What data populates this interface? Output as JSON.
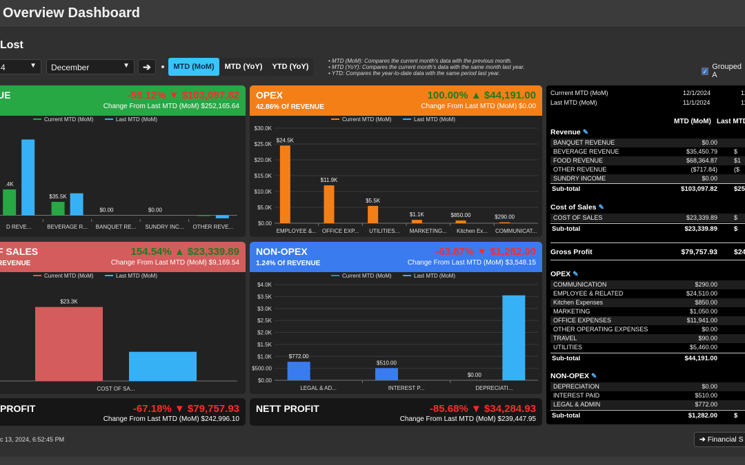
{
  "page": {
    "title": "Overview Dashboard",
    "section": "Lost",
    "timestamp": "c 13, 2024, 6:52:45 PM"
  },
  "controls": {
    "year_value": "4",
    "month_value": "December",
    "go_icon": "arrow-right-icon",
    "modes": [
      "MTD (MoM)",
      "MTD (YoY)",
      "YTD (YoY)"
    ],
    "active_mode": "MTD (MoM)",
    "notes": [
      "MTD (MoM): Compares the current month's data with the previous month.",
      "MTD (YoY): Compares the current month's data with the same month last year.",
      "YTD: Compares the year-to-date data with the same period last year."
    ],
    "grouped_label": "Grouped A"
  },
  "colors": {
    "current": "#1e8bd8",
    "last": "#37b1f5",
    "revenue": "#28a745",
    "opex": "#f57f17",
    "cos": "#d55c5c",
    "nonopex": "#3a7bf0",
    "up": "#22cc55",
    "down": "#ff2222"
  },
  "cards": {
    "revenue": {
      "title": "UE",
      "big": "-59.12% ▼ $103,097.82",
      "change": "Change From Last MTD (MoM) $252,165.64"
    },
    "opex": {
      "title": "OPEX",
      "sub": "42.86% Of REVENUE",
      "big": "100.00% ▲ $44,191.00",
      "change": "Change From Last MTD (MoM) $0.00"
    },
    "cos": {
      "title": "F SALES",
      "sub": "REVENUE",
      "big": "154.54% ▲ $23,339.89",
      "change": "Change From Last MTD (MoM) $9,169.54"
    },
    "nonopex": {
      "title": "NON-OPEX",
      "sub": "1.24% Of REVENUE",
      "big": "-63.87% ▼ $1,282.00",
      "change": "Change From Last MTD (MoM) $3,548.15"
    },
    "gross": {
      "title": "PROFIT",
      "big": "-67.18% ▼ $79,757.93",
      "change": "Change From Last MTD (MoM) $242,996.10"
    },
    "nett": {
      "title": "NETT PROFIT",
      "big": "-85.68% ▼ $34,284.93",
      "change": "Change From Last MTD (MoM) $239,447.95"
    }
  },
  "chart_data": [
    {
      "type": "bar",
      "id": "revenue",
      "categories": [
        "D REVE...",
        "BEVERAGE R...",
        "BANQUET RE...",
        "SUNDRY INC...",
        "OTHER REVE..."
      ],
      "series": [
        {
          "name": "Current MTD (MoM)",
          "values": [
            68364.87,
            35450.79,
            0,
            0,
            -717.84
          ]
        },
        {
          "name": "Last MTD (MoM)",
          "values": [
            200000,
            58000,
            0,
            0,
            -8000
          ]
        }
      ],
      "data_labels": [
        ".4K",
        "$35.5K",
        "$0.00",
        "$0.00",
        ""
      ],
      "ylim": [
        -10000,
        230000
      ]
    },
    {
      "type": "bar",
      "id": "opex",
      "categories": [
        "EMPLOYEE &...",
        "OFFICE EXP...",
        "UTILITIES...",
        "MARKETING...",
        "Kitchen Ex...",
        "COMMUNICAT..."
      ],
      "series": [
        {
          "name": "Current MTD (MoM)",
          "values": [
            24510,
            11941,
            5460,
            1050,
            850,
            290
          ]
        },
        {
          "name": "Last MTD (MoM)",
          "values": [
            0,
            0,
            0,
            0,
            0,
            0
          ]
        }
      ],
      "data_labels": [
        "$24.5K",
        "$11.9K",
        "$5.5K",
        "$1.1K",
        "$850.00",
        "$290.00"
      ],
      "yticks": [
        "$0.00",
        "$5.0K",
        "$10.0K",
        "$15.0K",
        "$20.0K",
        "$25.0K",
        "$30.0K"
      ],
      "ylim": [
        0,
        30000
      ]
    },
    {
      "type": "bar",
      "id": "cos",
      "categories": [
        "COST OF SA..."
      ],
      "series": [
        {
          "name": "Current MTD (MoM)",
          "values": [
            23339.89
          ]
        },
        {
          "name": "Last MTD (MoM)",
          "values": [
            9200
          ]
        }
      ],
      "data_labels": [
        "$23.3K"
      ],
      "ylim": [
        0,
        30000
      ]
    },
    {
      "type": "bar",
      "id": "nonopex",
      "categories": [
        "LEGAL & AD...",
        "INTEREST P...",
        "DEPRECIATI..."
      ],
      "series": [
        {
          "name": "Current MTD (MoM)",
          "values": [
            772,
            510,
            0
          ]
        },
        {
          "name": "Last MTD (MoM)",
          "values": [
            0,
            0,
            3548
          ]
        }
      ],
      "data_labels": [
        "$772.00",
        "$510.00",
        "$0.00"
      ],
      "yticks": [
        "$0.00",
        "$500.00",
        "$1.0K",
        "$1.5K",
        "$2.0K",
        "$2.5K",
        "$3.0K",
        "$3.5K",
        "$4.0K"
      ],
      "ylim": [
        0,
        4000
      ]
    }
  ],
  "panel": {
    "current_label": "Currrent MTD (MoM)",
    "current_date": "12/1/2024",
    "current_date2": "12",
    "last_label": "Last MTD (MoM)",
    "last_date": "11/1/2024",
    "last_date2": "11",
    "col_header": "MTD (MoM)",
    "col_header2": "Last MTD",
    "revenue": {
      "title": "Revenue",
      "rows": [
        {
          "label": "BANQUET REVENUE",
          "value": "$0.00",
          "value2": ""
        },
        {
          "label": "BEVERAGE REVENUE",
          "value": "$35,450.79",
          "value2": "$"
        },
        {
          "label": "FOOD REVENUE",
          "value": "$68,364.87",
          "value2": "$1"
        },
        {
          "label": "OTHER REVENUE",
          "value": "($717.84)",
          "value2": "($"
        },
        {
          "label": "SUNDRY INCOME",
          "value": "$0.00",
          "value2": ""
        }
      ],
      "subtotal": "$103,097.82",
      "subtotal2": "$25"
    },
    "cos": {
      "title": "Cost of Sales",
      "rows": [
        {
          "label": "COST OF SALES",
          "value": "$23,339.89",
          "value2": "$"
        }
      ],
      "subtotal": "$23,339.89",
      "subtotal2": "$"
    },
    "gross": {
      "label": "Gross Profit",
      "value": "$79,757.93",
      "value2": "$24"
    },
    "opex": {
      "title": "OPEX",
      "rows": [
        {
          "label": "COMMUNICATION",
          "value": "$290.00",
          "value2": ""
        },
        {
          "label": "EMPLOYEE & RELATED",
          "value": "$24,510.00",
          "value2": ""
        },
        {
          "label": "Kitchen Expenses",
          "value": "$850.00",
          "value2": ""
        },
        {
          "label": "MARKETING",
          "value": "$1,050.00",
          "value2": ""
        },
        {
          "label": "OFFICE EXPENSES",
          "value": "$11,941.00",
          "value2": ""
        },
        {
          "label": "OTHER OPERATING EXPENSES",
          "value": "$0.00",
          "value2": ""
        },
        {
          "label": "TRAVEL",
          "value": "$90.00",
          "value2": ""
        },
        {
          "label": "UTILITIES",
          "value": "$5,460.00",
          "value2": ""
        }
      ],
      "subtotal": "$44,191.00",
      "subtotal2": ""
    },
    "nonopex": {
      "title": "NON-OPEX",
      "rows": [
        {
          "label": "DEPRECIATION",
          "value": "$0.00",
          "value2": ""
        },
        {
          "label": "INTEREST PAID",
          "value": "$510.00",
          "value2": ""
        },
        {
          "label": "LEGAL & ADMIN",
          "value": "$772.00",
          "value2": ""
        }
      ],
      "subtotal": "$1,282.00",
      "subtotal2": "$"
    }
  },
  "footer": {
    "financial_button": "Financial S",
    "button_icon": "arrow-right-icon"
  }
}
